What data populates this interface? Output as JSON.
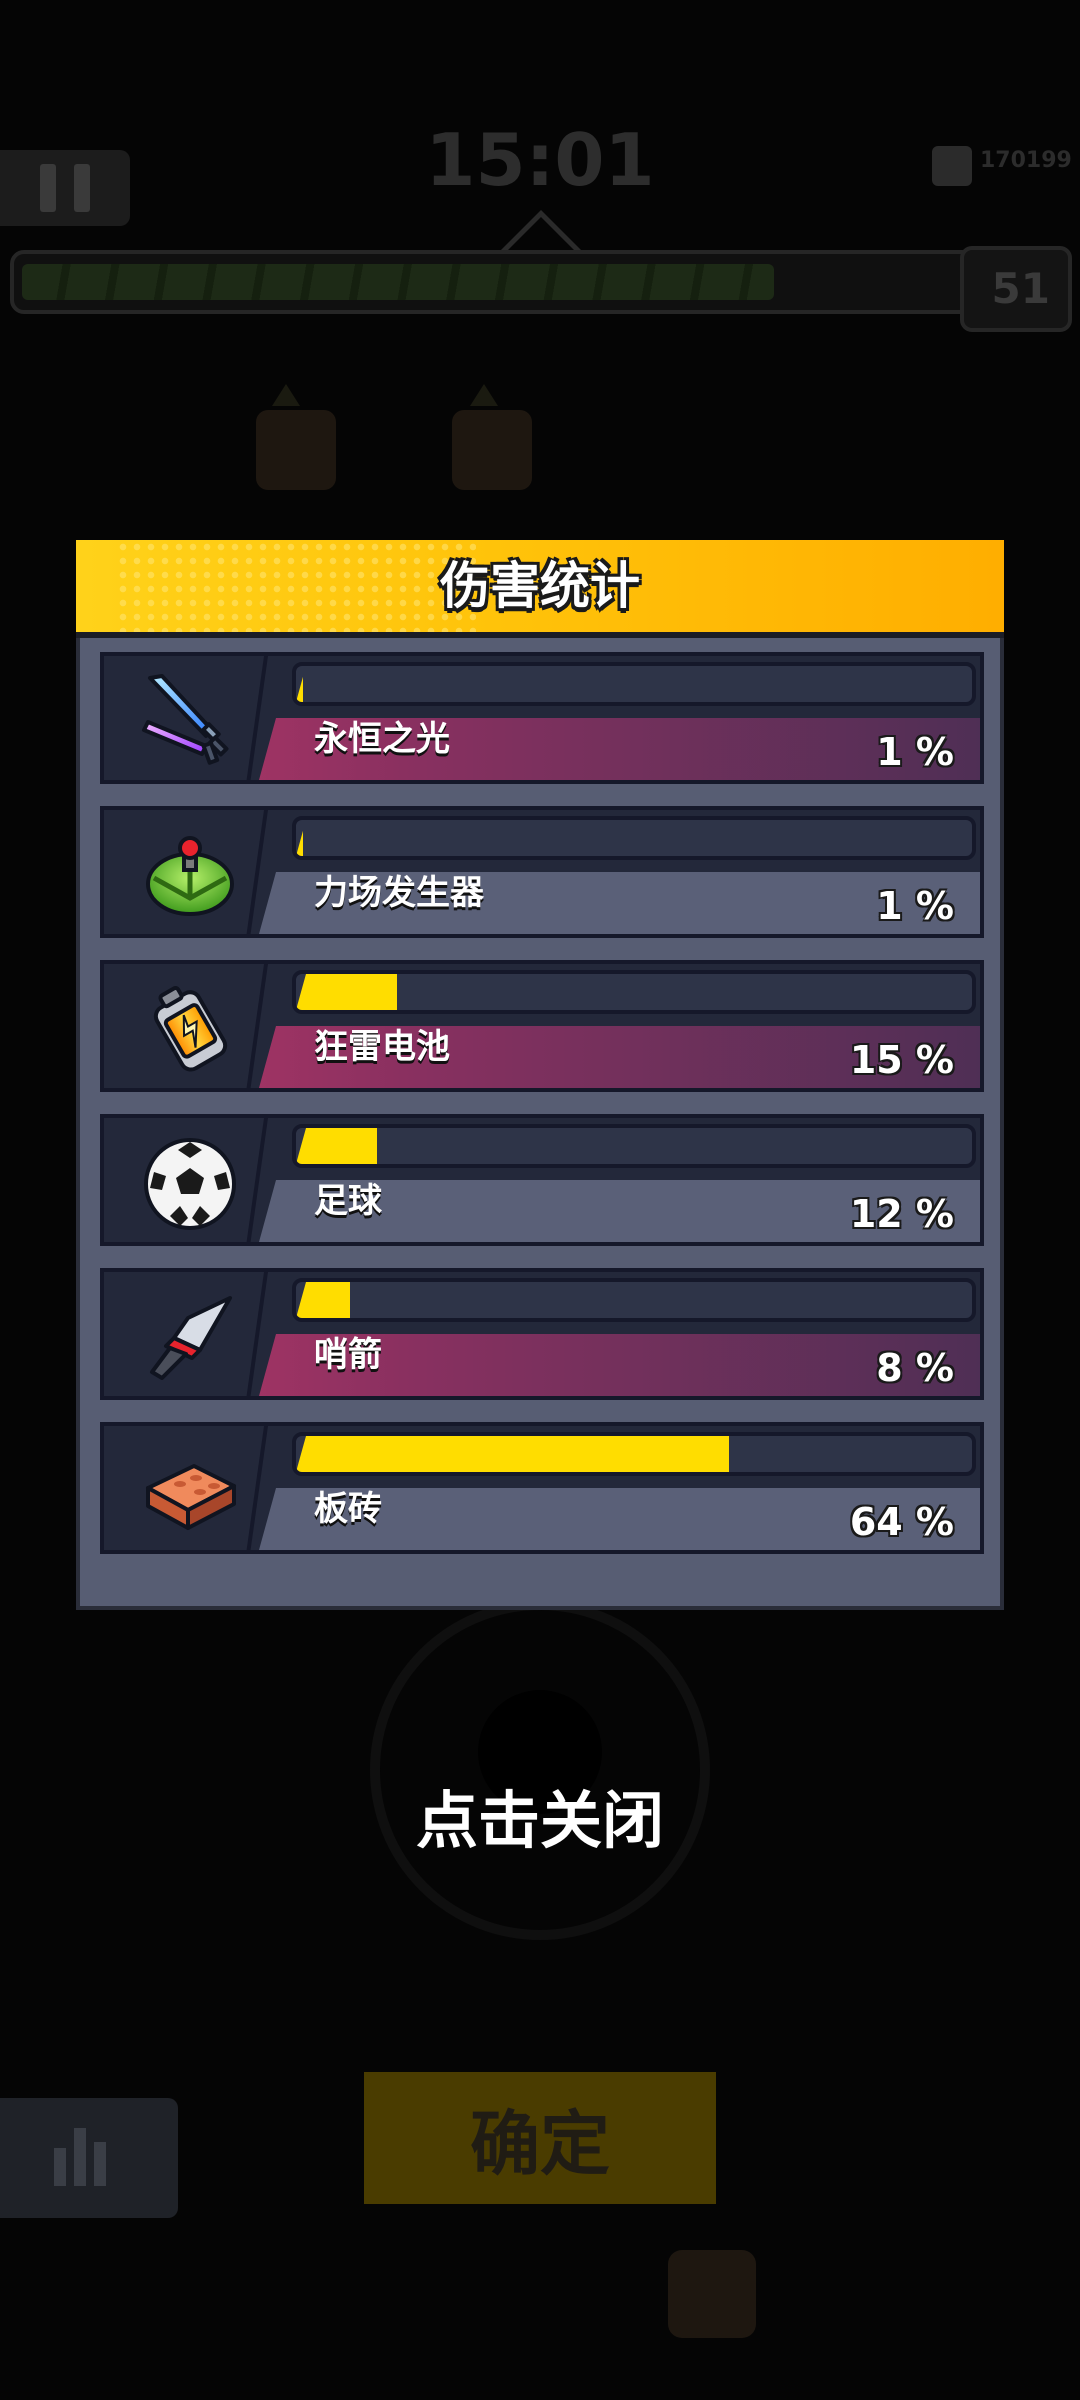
{
  "hud": {
    "timer": "15:01",
    "gems": "170199",
    "level": "51",
    "xp_progress": 0.72
  },
  "modal": {
    "title": "伤害统计",
    "rows": [
      {
        "name": "永恒之光",
        "percent": 1,
        "percent_label": "1 %",
        "icon": "dual-sword-icon",
        "style": "pink"
      },
      {
        "name": "力场发生器",
        "percent": 1,
        "percent_label": "1 %",
        "icon": "force-field-generator-icon",
        "style": "slate"
      },
      {
        "name": "狂雷电池",
        "percent": 15,
        "percent_label": "15 %",
        "icon": "thunder-battery-icon",
        "style": "pink"
      },
      {
        "name": "足球",
        "percent": 12,
        "percent_label": "12 %",
        "icon": "soccer-ball-icon",
        "style": "slate"
      },
      {
        "name": "哨箭",
        "percent": 8,
        "percent_label": "8 %",
        "icon": "kunai-icon",
        "style": "pink"
      },
      {
        "name": "板砖",
        "percent": 64,
        "percent_label": "64 %",
        "icon": "brick-icon",
        "style": "slate"
      }
    ]
  },
  "close_hint": "点击关闭",
  "confirm_label": "确定",
  "colors": {
    "header": "#ffc30a",
    "bar_fill": "#ffdd00",
    "panel": "#575d73",
    "row_dark": "#23283a"
  }
}
